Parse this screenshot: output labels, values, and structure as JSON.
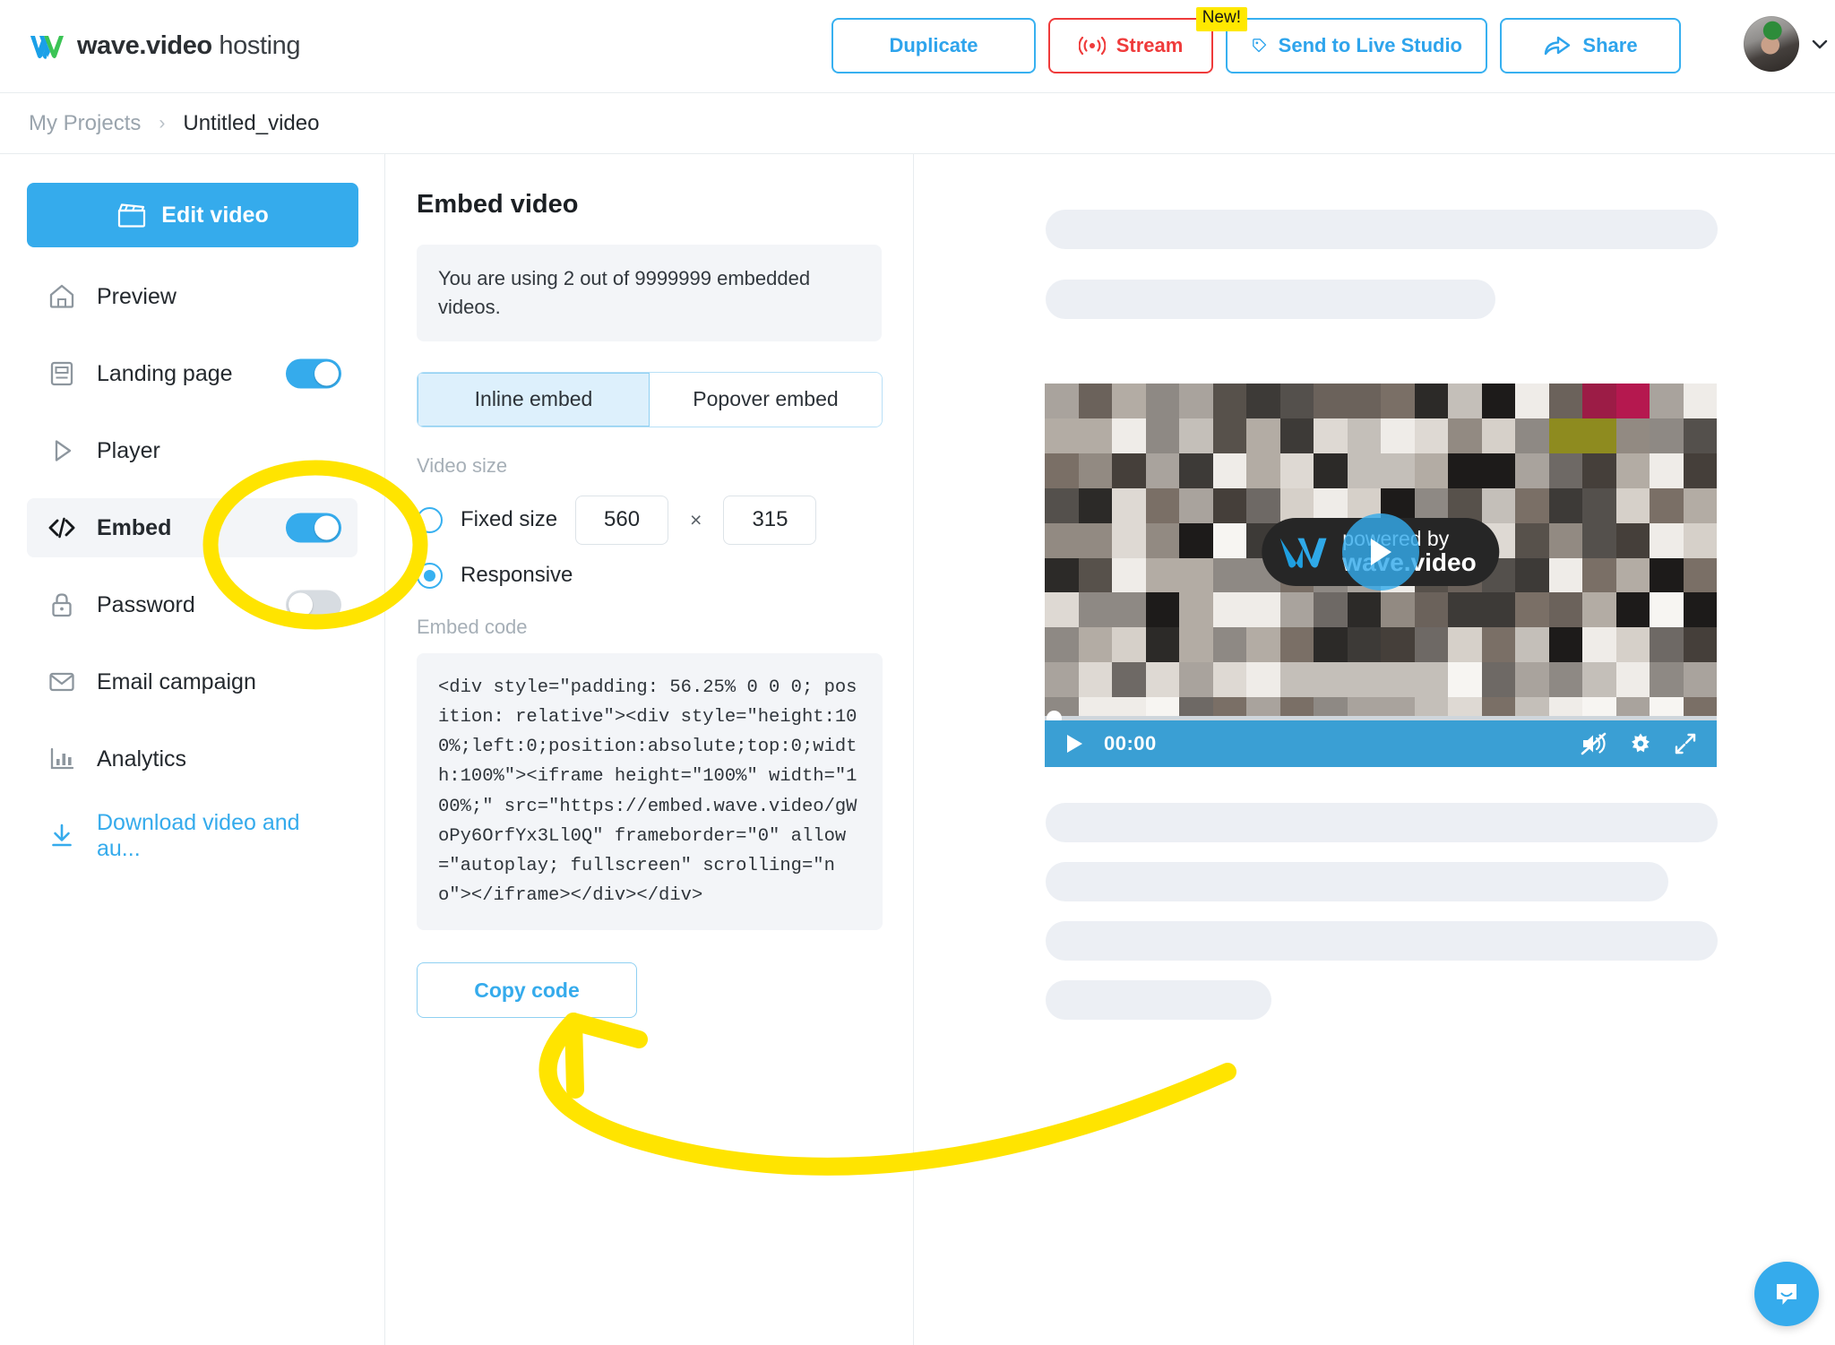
{
  "header": {
    "brand_bold": "wave.video",
    "brand_light": " hosting",
    "logo_icon": "wave-w-logo",
    "buttons": [
      {
        "label": "Duplicate",
        "icon": "none",
        "style": "blue"
      },
      {
        "label": "Stream",
        "icon": "broadcast-icon",
        "style": "red",
        "badge": "New!"
      },
      {
        "label": "Send to Live Studio",
        "icon": "tag-icon",
        "style": "blue"
      },
      {
        "label": "Share",
        "icon": "share-arrow-icon",
        "style": "blue"
      }
    ],
    "avatar_icon": "user-avatar",
    "chevron_icon": "chevron-down-icon"
  },
  "breadcrumb": {
    "parent": "My Projects",
    "separator": "›",
    "current": "Untitled_video"
  },
  "sidebar": {
    "edit_button": {
      "label": "Edit video",
      "icon": "clapperboard-icon"
    },
    "items": [
      {
        "label": "Preview",
        "icon": "home-icon",
        "toggle": null,
        "active": false
      },
      {
        "label": "Landing page",
        "icon": "landing-page-icon",
        "toggle": "on",
        "active": false
      },
      {
        "label": "Player",
        "icon": "play-icon",
        "toggle": null,
        "active": false
      },
      {
        "label": "Embed",
        "icon": "code-icon",
        "toggle": "on",
        "active": true
      },
      {
        "label": "Password",
        "icon": "lock-icon",
        "toggle": "off",
        "active": false
      },
      {
        "label": "Email campaign",
        "icon": "envelope-icon",
        "toggle": null,
        "active": false
      },
      {
        "label": "Analytics",
        "icon": "bar-chart-icon",
        "toggle": null,
        "active": false
      },
      {
        "label": "Download video and au...",
        "icon": "download-icon",
        "toggle": null,
        "active": false,
        "link": true
      }
    ]
  },
  "panel": {
    "title": "Embed video",
    "notice": "You are using 2 out of 9999999 embedded videos.",
    "tabs": [
      {
        "label": "Inline embed",
        "active": true
      },
      {
        "label": "Popover embed",
        "active": false
      }
    ],
    "video_size_label": "Video size",
    "fixed_size_label": "Fixed size",
    "responsive_label": "Responsive",
    "selected_size_mode": "Responsive",
    "width_value": "560",
    "height_value": "315",
    "multiply_symbol": "×",
    "embed_code_label": "Embed code",
    "embed_code": "<div style=\"padding: 56.25% 0 0 0; position: relative\"><div style=\"height:100%;left:0;position:absolute;top:0;width:100%\"><iframe height=\"100%\" width=\"100%;\" src=\"https://embed.wave.video/gWoPy6OrfYx3Ll0Q\" frameborder=\"0\" allow=\"autoplay; fullscreen\" scrolling=\"no\"></iframe></div></div>",
    "copy_button": "Copy code"
  },
  "preview": {
    "player": {
      "play_icon": "play-icon",
      "time": "00:00",
      "mute_icon": "muted-speaker-icon",
      "settings_icon": "gear-icon",
      "fullscreen_icon": "fullscreen-icon",
      "overlay_line1": "powered by",
      "overlay_line2": "wave.video",
      "overlay_logo_icon": "wave-w-logo",
      "center_play_icon": "play-button-icon"
    }
  },
  "chat_widget": {
    "icon": "chat-bubble-icon"
  },
  "annotations": {
    "circle_target": "embed-toggle",
    "arrow_target": "copy-code-button",
    "color": "#ffe400"
  },
  "colors": {
    "accent_blue": "#35abec",
    "stream_red": "#ef3b3b",
    "badge_yellow": "#ffe800",
    "panel_grey": "#f3f5f8",
    "highlight_yellow": "#ffe400"
  }
}
